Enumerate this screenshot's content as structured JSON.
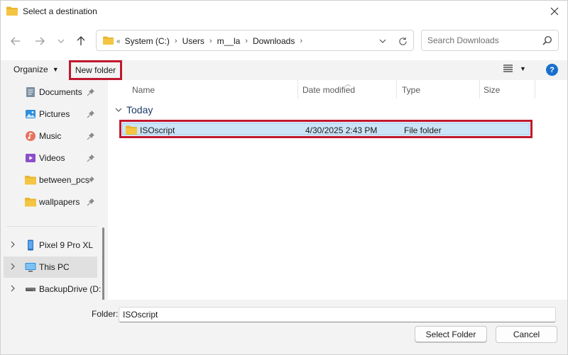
{
  "window": {
    "title": "Select a destination"
  },
  "nav": {
    "breadcrumb": [
      "System (C:)",
      "Users",
      "m__la",
      "Downloads"
    ],
    "overflow": "«",
    "search_placeholder": "Search Downloads"
  },
  "toolbar": {
    "organize_label": "Organize",
    "new_folder_label": "New folder",
    "help_label": "?"
  },
  "sidebar": {
    "quick_access": [
      {
        "label": "Documents",
        "icon": "documents-icon"
      },
      {
        "label": "Pictures",
        "icon": "pictures-icon"
      },
      {
        "label": "Music",
        "icon": "music-icon"
      },
      {
        "label": "Videos",
        "icon": "videos-icon"
      },
      {
        "label": "between_pcs",
        "icon": "folder-icon"
      },
      {
        "label": "wallpapers",
        "icon": "folder-icon"
      }
    ],
    "devices": [
      {
        "label": "Pixel 9 Pro XL",
        "icon": "phone-icon"
      },
      {
        "label": "This PC",
        "icon": "monitor-icon",
        "selected": true
      },
      {
        "label": "BackupDrive (D:",
        "icon": "drive-icon"
      }
    ]
  },
  "columns": {
    "name": "Name",
    "date": "Date modified",
    "type": "Type",
    "size": "Size"
  },
  "group": {
    "label": "Today"
  },
  "files": [
    {
      "name": "ISOscript",
      "date": "4/30/2025 2:43 PM",
      "type": "File folder",
      "size": ""
    }
  ],
  "footer": {
    "folder_label": "Folder:",
    "folder_value": "ISOscript",
    "select_label": "Select Folder",
    "cancel_label": "Cancel"
  },
  "colors": {
    "highlight_box": "#c0182e",
    "selection": "#cce4f7",
    "folder": "#f4c542",
    "accent": "#1a6fce"
  }
}
